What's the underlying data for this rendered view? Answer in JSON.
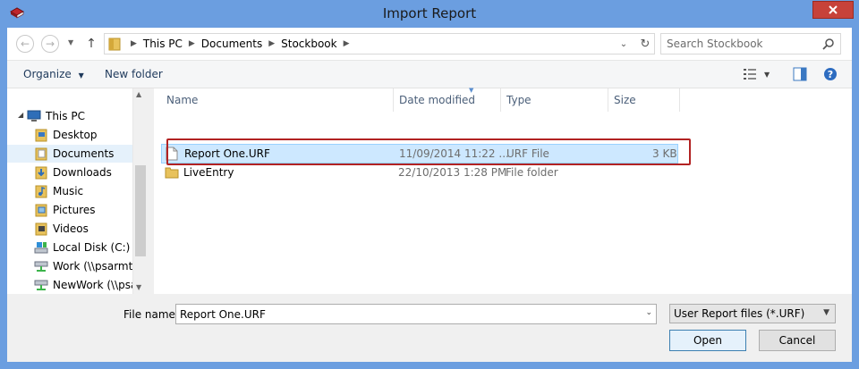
{
  "window": {
    "title": "Import Report"
  },
  "address": {
    "crumbs": [
      "This PC",
      "Documents",
      "Stockbook"
    ]
  },
  "search": {
    "placeholder": "Search Stockbook"
  },
  "toolbar": {
    "organize_label": "Organize",
    "new_folder_label": "New folder"
  },
  "nav": {
    "items": [
      {
        "label": "This PC",
        "icon": "computer-icon"
      },
      {
        "label": "Desktop",
        "icon": "desktop-folder-icon"
      },
      {
        "label": "Documents",
        "icon": "documents-folder-icon"
      },
      {
        "label": "Downloads",
        "icon": "downloads-folder-icon"
      },
      {
        "label": "Music",
        "icon": "music-folder-icon"
      },
      {
        "label": "Pictures",
        "icon": "pictures-folder-icon"
      },
      {
        "label": "Videos",
        "icon": "videos-folder-icon"
      },
      {
        "label": "Local Disk (C:)",
        "icon": "drive-icon"
      },
      {
        "label": "Work (\\\\psarmts)",
        "icon": "network-drive-icon"
      },
      {
        "label": "NewWork (\\\\psar",
        "icon": "network-drive-icon"
      }
    ],
    "selected": "Documents"
  },
  "list": {
    "columns": [
      "Name",
      "Date modified",
      "Type",
      "Size"
    ],
    "rows": [
      {
        "name": "Report One.URF",
        "date": "11/09/2014 11:22 ...",
        "type": "URF File",
        "size": "3 KB",
        "icon": "file-icon"
      },
      {
        "name": "LiveEntry",
        "date": "22/10/2013 1:28 PM",
        "type": "File folder",
        "size": "",
        "icon": "folder-icon"
      }
    ]
  },
  "footer": {
    "file_name_label": "File name:",
    "file_name_value": "Report One.URF",
    "filter_value": "User Report files (*.URF)",
    "open_label": "Open",
    "cancel_label": "Cancel"
  },
  "colors": {
    "title_bar": "#6b9ee0",
    "close_button": "#c7423a",
    "selection_fill": "#cde8ff",
    "highlight_frame": "#b22222"
  }
}
